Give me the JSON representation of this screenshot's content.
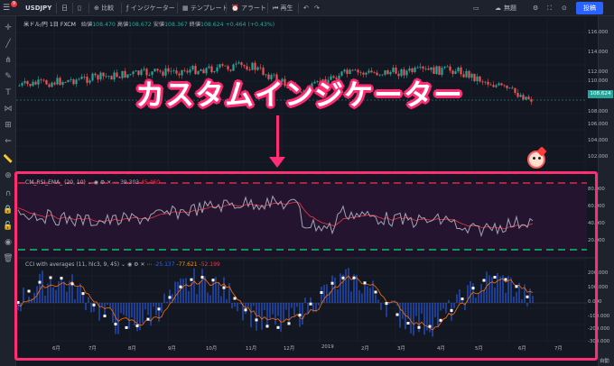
{
  "toolbar": {
    "symbol": "USDJPY",
    "interval": "日",
    "compare": "比較",
    "indicators": "インジケーター",
    "templates": "テンプレート",
    "alert": "アラート",
    "replay": "再生",
    "untitled": "無題",
    "publish": "投稿",
    "badge": "9"
  },
  "legend": {
    "name": "米ドル/円",
    "interval": "1日",
    "exchange": "FXCM",
    "open_label": "始値",
    "open": "108.470",
    "high_label": "高値",
    "high": "108.672",
    "low_label": "安値",
    "low": "108.367",
    "close_label": "終値",
    "close": "108.624",
    "change": "+0.464 (+0.43%)"
  },
  "price_axis": [
    "116.000",
    "114.000",
    "112.000",
    "110.000",
    "108.000",
    "106.000",
    "104.000",
    "102.000"
  ],
  "current_price": "108.624",
  "rsi_axis": [
    "80.000",
    "60.000",
    "40.000",
    "20.000"
  ],
  "cci_axis": [
    "200.000",
    "100.000",
    "0.000",
    "-100.000",
    "-200.000",
    "-300.000"
  ],
  "annotation": {
    "title": "カスタムインジケーター"
  },
  "rsi_pane": {
    "name": "CM_RSI_EMA_",
    "params": "(20, 10)",
    "value1": "39.303",
    "value2": "45.460"
  },
  "cci_pane": {
    "name": "CCI with averages",
    "params": "(11, hlc3, 9, 45)",
    "value1": "-25.137",
    "value2": "-77.621",
    "value3": "-52.199"
  },
  "dates": [
    "6月",
    "7月",
    "8月",
    "9月",
    "10月",
    "11月",
    "12月",
    "2019",
    "2月",
    "3月",
    "4月",
    "5月",
    "6月",
    "7月"
  ],
  "auto_label": "自動",
  "colors": {
    "up": "#26a69a",
    "down": "#ef5350",
    "rsi_line": "#a1a5b4",
    "rsi_ema": "#f23645",
    "overbought": "#f23645",
    "oversold": "#00e676",
    "cci_hist": "#2962ff",
    "cci_avg": "#ff6d00",
    "highlight": "#ff2d73"
  }
}
